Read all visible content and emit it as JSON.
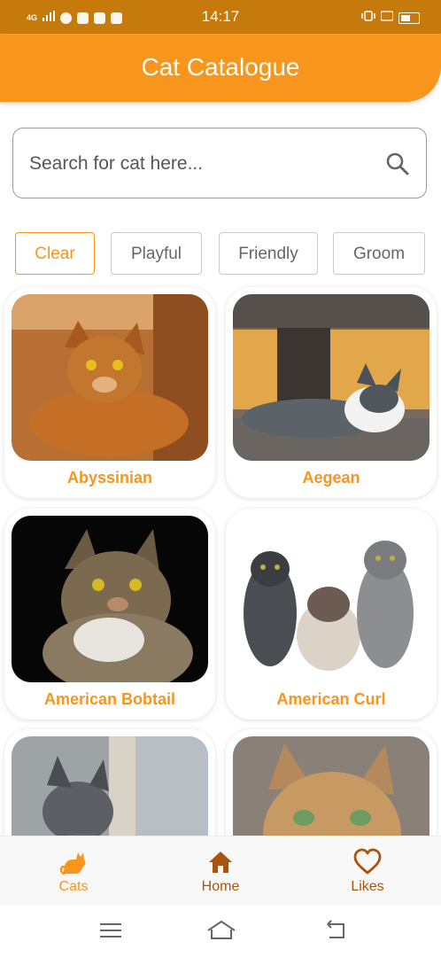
{
  "status_bar": {
    "network": "4G",
    "time": "14:17",
    "icons": [
      "signal-icon",
      "whatsapp-icon",
      "youtube-icon",
      "instagram-icon",
      "mail-icon",
      "vibrate-icon",
      "volte-icon",
      "battery-icon"
    ]
  },
  "header": {
    "title": "Cat Catalogue"
  },
  "search": {
    "placeholder": "Search for cat here...",
    "value": "",
    "icon": "search-icon"
  },
  "filters": [
    {
      "label": "Clear",
      "active": true
    },
    {
      "label": "Playful",
      "active": false
    },
    {
      "label": "Friendly",
      "active": false
    },
    {
      "label": "Groom",
      "active": false
    }
  ],
  "cats": [
    {
      "name": "Abyssinian"
    },
    {
      "name": "Aegean"
    },
    {
      "name": "American Bobtail"
    },
    {
      "name": "American Curl"
    },
    {
      "name": ""
    },
    {
      "name": ""
    }
  ],
  "bottom_nav": [
    {
      "label": "Cats",
      "icon": "cat-icon",
      "active": true
    },
    {
      "label": "Home",
      "icon": "home-icon",
      "active": false
    },
    {
      "label": "Likes",
      "icon": "heart-icon",
      "active": false
    }
  ],
  "colors": {
    "accent": "#f7951d",
    "status_bar": "#c77a0c",
    "nav_active": "#f7951d",
    "nav_inactive": "#a8530f"
  }
}
